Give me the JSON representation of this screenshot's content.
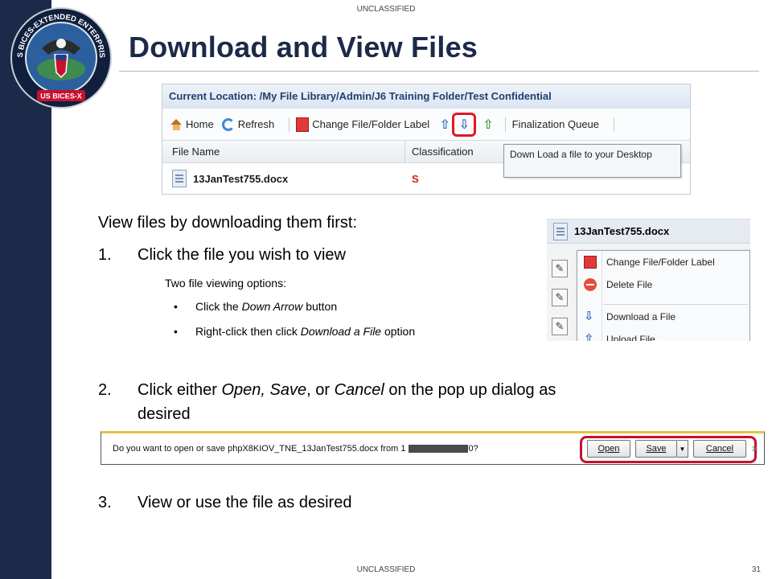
{
  "header": {
    "classification_top": "UNCLASSIFIED",
    "title": "Download and View Files",
    "logo_text": "US BICES-EXTENDED ENTERPRISE",
    "logo_subtext": "US BICES-X"
  },
  "footer": {
    "classification_bottom": "UNCLASSIFIED",
    "page_number": "31"
  },
  "screenshot_library": {
    "location": "Current Location: /My File Library/Admin/J6 Training Folder/Test Confidential",
    "toolbar": {
      "home": "Home",
      "refresh": "Refresh",
      "change_label": "Change File/Folder Label",
      "finalization": "Finalization Queue"
    },
    "columns": {
      "file_name": "File Name",
      "classification": "Classification"
    },
    "row": {
      "file": "13JanTest755.docx",
      "classification": "S"
    },
    "tooltip": "Down Load a file to your Desktop"
  },
  "instructions": {
    "intro": "View files by downloading them first:",
    "step1_num": "1.",
    "step1": "Click the file you wish to view",
    "options_label": "Two file viewing options:",
    "bullet_char": "•",
    "opt1_pre": "Click the ",
    "opt1_em": "Down Arrow",
    "opt1_post": " button",
    "opt2_pre": "Right-click then click ",
    "opt2_em": "Download a File",
    "opt2_post": " option",
    "step2_num": "2.",
    "step2_pre": "Click either ",
    "step2_open": "Open,",
    "step2_save": "Save",
    "step2_mid": ", or ",
    "step2_cancel": "Cancel",
    "step2_post": " on the pop up dialog as",
    "step2_line2": "desired",
    "step3_num": "3.",
    "step3": "View or use the file as desired"
  },
  "screenshot_menu": {
    "file": "13JanTest755.docx",
    "items": {
      "change_label": "Change File/Folder Label",
      "delete": "Delete File",
      "download": "Download a File",
      "upload": "Upload File"
    }
  },
  "screenshot_dialog": {
    "question_pre": "Do you want to open or save phpX8KIOV_TNE_13JanTest755.docx from 1",
    "question_post": "0?",
    "open": "Open",
    "save": "Save",
    "cancel": "Cancel"
  },
  "colors": {
    "sidebar": "#1b2a48",
    "title": "#1b2a48",
    "highlight_red": "#e01921"
  }
}
